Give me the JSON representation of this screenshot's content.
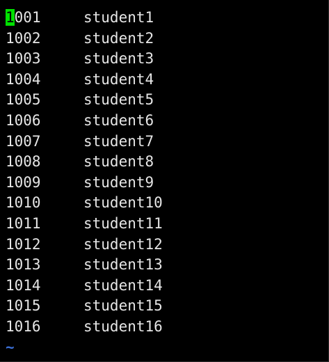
{
  "editor": {
    "cursor_char": "1",
    "lines": [
      {
        "id_rest": "001",
        "name": "student1"
      },
      {
        "id": "1002",
        "name": "student2"
      },
      {
        "id": "1003",
        "name": "student3"
      },
      {
        "id": "1004",
        "name": "student4"
      },
      {
        "id": "1005",
        "name": "student5"
      },
      {
        "id": "1006",
        "name": "student6"
      },
      {
        "id": "1007",
        "name": "student7"
      },
      {
        "id": "1008",
        "name": "student8"
      },
      {
        "id": "1009",
        "name": "student9"
      },
      {
        "id": "1010",
        "name": "student10"
      },
      {
        "id": "1011",
        "name": "student11"
      },
      {
        "id": "1012",
        "name": "student12"
      },
      {
        "id": "1013",
        "name": "student13"
      },
      {
        "id": "1014",
        "name": "student14"
      },
      {
        "id": "1015",
        "name": "student15"
      },
      {
        "id": "1016",
        "name": "student16"
      }
    ],
    "empty_line_marker": "~"
  },
  "colors": {
    "background": "#000000",
    "text": "#e6e6e6",
    "cursor": "#00e000",
    "tilde": "#3b6fd6"
  }
}
